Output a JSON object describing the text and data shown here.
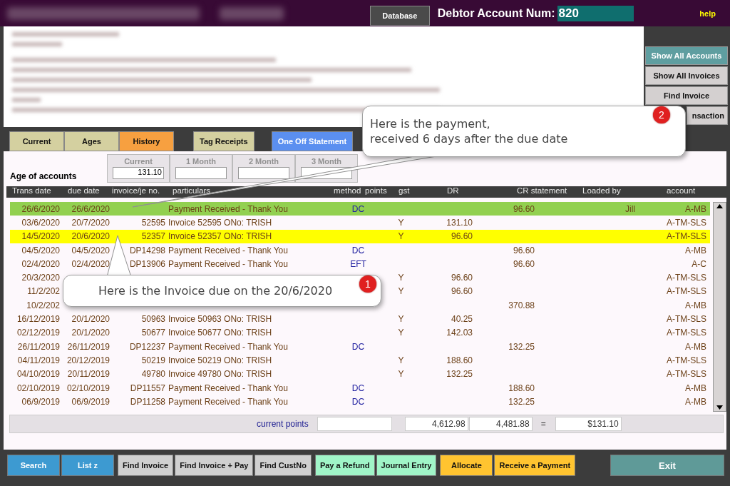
{
  "top_bar": {
    "database_button": "Database",
    "account_label": "Debtor Account Num:",
    "account_number": "820",
    "help": "help"
  },
  "side_buttons": [
    {
      "label": "Show All Accounts",
      "selected": true
    },
    {
      "label": "Show All Invoices",
      "selected": false
    },
    {
      "label": "Find Invoice",
      "selected": false
    },
    {
      "label": "nsaction",
      "selected": false
    }
  ],
  "tabs": [
    {
      "label": "Current",
      "selected": false
    },
    {
      "label": "Ages",
      "selected": false
    },
    {
      "label": "History",
      "selected": true
    }
  ],
  "tab_buttons": [
    {
      "label": "Tag Receipts",
      "kind": "tan"
    },
    {
      "label": "One Off Statement",
      "kind": "blue"
    }
  ],
  "ages": {
    "title": "Age of accounts",
    "buckets": [
      {
        "label": "Current",
        "value": "131.10"
      },
      {
        "label": "1 Month"
      },
      {
        "label": "2 Month"
      },
      {
        "label": "3 Month"
      }
    ]
  },
  "table": {
    "columns": [
      "Trans date",
      "due date",
      "invoice/je no.",
      "particulars",
      "method",
      "points",
      "gst",
      "DR",
      "CR statement",
      "Loaded by",
      "account"
    ],
    "rows": [
      {
        "trans_date": "26/6/2020",
        "due_date": "26/6/2020",
        "particulars": "Payment Received - Thank You",
        "method": "DC",
        "cr": "96.60",
        "loaded_by": "Jill",
        "account": "A-MB",
        "color": "#92d050"
      },
      {
        "trans_date": "03/6/2020",
        "due_date": "20/7/2020",
        "invoice": "52595",
        "particulars": "Invoice 52595 ONo: TRISH",
        "gst": "Y",
        "dr": "131.10",
        "account": "A-TM-SLS"
      },
      {
        "trans_date": "14/5/2020",
        "due_date": "20/6/2020",
        "invoice": "52357",
        "particulars": "Invoice 52357 ONo: TRISH",
        "gst": "Y",
        "dr": "96.60",
        "account": "A-TM-SLS",
        "color": "#ffff00"
      },
      {
        "trans_date": "04/5/2020",
        "due_date": "04/5/2020",
        "invoice": "DP14298",
        "particulars": "Payment Received - Thank You",
        "method": "DC",
        "cr": "96.60",
        "account": "A-MB"
      },
      {
        "trans_date": "02/4/2020",
        "due_date": "02/4/2020",
        "invoice": "DP13906",
        "particulars": "Payment Received - Thank You",
        "method": "EFT",
        "cr": "96.60",
        "account": "A-C"
      },
      {
        "trans_date": "20/3/2020",
        "gst": "Y",
        "dr": "96.60",
        "account": "A-TM-SLS"
      },
      {
        "trans_date": "11/2/202",
        "gst": "Y",
        "dr": "96.60",
        "account": "A-TM-SLS"
      },
      {
        "trans_date": "10/2/202",
        "cr": "370.88",
        "account": "A-MB"
      },
      {
        "trans_date": "16/12/2019",
        "due_date": "20/1/2020",
        "invoice": "50963",
        "particulars": "Invoice 50963 ONo: TRISH",
        "gst": "Y",
        "dr": "40.25",
        "account": "A-TM-SLS"
      },
      {
        "trans_date": "02/12/2019",
        "due_date": "20/1/2020",
        "invoice": "50677",
        "particulars": "Invoice 50677 ONo: TRISH",
        "gst": "Y",
        "dr": "142.03",
        "account": "A-TM-SLS"
      },
      {
        "trans_date": "26/11/2019",
        "due_date": "26/11/2019",
        "invoice": "DP12237",
        "particulars": "Payment Received - Thank You",
        "method": "DC",
        "cr": "132.25",
        "account": "A-MB"
      },
      {
        "trans_date": "04/11/2019",
        "due_date": "20/12/2019",
        "invoice": "50219",
        "particulars": "Invoice 50219 ONo: TRISH",
        "gst": "Y",
        "dr": "188.60",
        "account": "A-TM-SLS"
      },
      {
        "trans_date": "04/10/2019",
        "due_date": "20/11/2019",
        "invoice": "49780",
        "particulars": "Invoice 49780 ONo: TRISH",
        "gst": "Y",
        "dr": "132.25",
        "account": "A-TM-SLS"
      },
      {
        "trans_date": "02/10/2019",
        "due_date": "02/10/2019",
        "invoice": "DP11557",
        "particulars": "Payment Received - Thank You",
        "method": "DC",
        "cr": "188.60",
        "account": "A-MB"
      },
      {
        "trans_date": "06/9/2019",
        "due_date": "06/9/2019",
        "invoice": "DP11258",
        "particulars": "Payment Received - Thank You",
        "method": "DC",
        "cr": "132.25",
        "account": "A-MB"
      }
    ]
  },
  "totals": {
    "label": "current points",
    "dr": "4,612.98",
    "cr": "4,481.88",
    "equals": "=",
    "balance": "$131.10"
  },
  "toolbar": [
    {
      "label": "Search",
      "kind": "blue"
    },
    {
      "label": "List z",
      "kind": "blue"
    },
    {
      "label": "Find Invoice",
      "kind": "gray"
    },
    {
      "label": "Find Invoice + Pay",
      "kind": "gray"
    },
    {
      "label": "Find CustNo",
      "kind": "gray"
    },
    {
      "label": "Pay a Refund",
      "kind": "mint"
    },
    {
      "label": "Journal Entry",
      "kind": "mint"
    },
    {
      "label": "Allocate",
      "kind": "yellow"
    },
    {
      "label": "Receive a Payment",
      "kind": "yellow"
    },
    {
      "label": "Exit",
      "kind": "exit"
    }
  ],
  "callouts": [
    {
      "number": "1",
      "lines": [
        "Here is the Invoice due on the 20/6/2020"
      ]
    },
    {
      "number": "2",
      "lines": [
        "Here is the payment,",
        "received 6 days after the due date"
      ]
    }
  ]
}
